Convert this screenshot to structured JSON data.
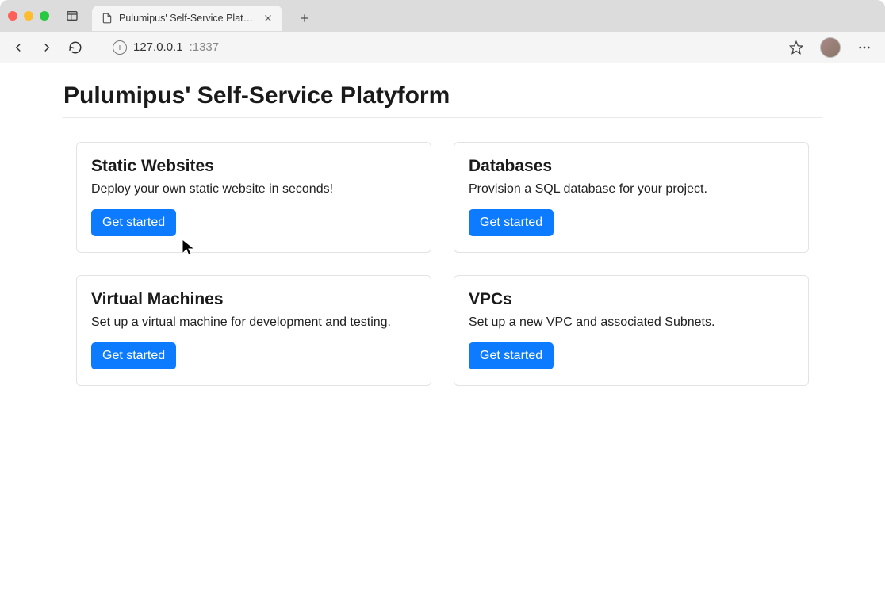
{
  "browser": {
    "tab_title": "Pulumipus' Self-Service Platyf...",
    "url_host": "127.0.0.1",
    "url_port": ":1337"
  },
  "page": {
    "title": "Pulumipus' Self-Service Platyform"
  },
  "cards": [
    {
      "title": "Static Websites",
      "desc": "Deploy your own static website in seconds!",
      "cta": "Get started"
    },
    {
      "title": "Databases",
      "desc": "Provision a SQL database for your project.",
      "cta": "Get started"
    },
    {
      "title": "Virtual Machines",
      "desc": "Set up a virtual machine for development and testing.",
      "cta": "Get started"
    },
    {
      "title": "VPCs",
      "desc": "Set up a new VPC and associated Subnets.",
      "cta": "Get started"
    }
  ],
  "colors": {
    "primary": "#0d7bff"
  }
}
